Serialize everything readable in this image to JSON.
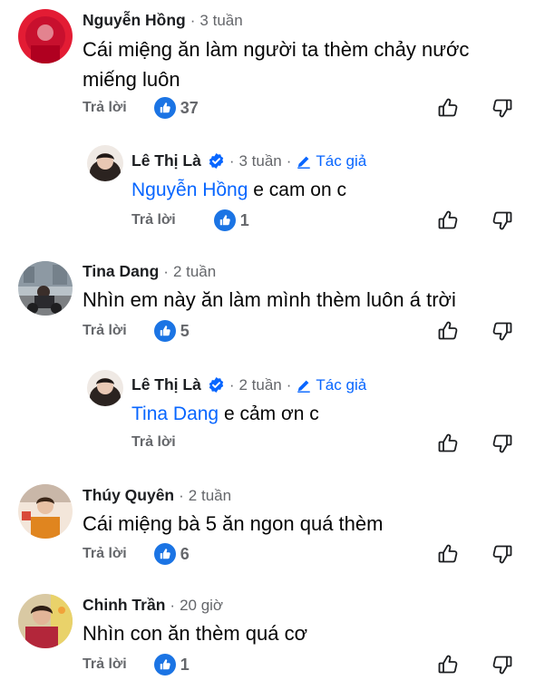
{
  "comments": [
    {
      "author": "Nguyễn Hồng",
      "time": "3 tuần",
      "text": "Cái miệng ăn làm người ta thèm chảy nước miếng luôn",
      "reply_label": "Trả lời",
      "likes": "37"
    },
    {
      "author": "Lê Thị Là",
      "time": "3 tuần",
      "author_badge": "Tác giả",
      "mention": "Nguyễn Hồng",
      "text": "e cam on c",
      "reply_label": "Trả lời",
      "likes": "1"
    },
    {
      "author": "Tina Dang",
      "time": "2 tuần",
      "text": "Nhìn em này ăn làm mình thèm luôn á trời",
      "reply_label": "Trả lời",
      "likes": "5"
    },
    {
      "author": "Lê Thị Là",
      "time": "2 tuần",
      "author_badge": "Tác giả",
      "mention": "Tina Dang",
      "text": "e cảm ơn c",
      "reply_label": "Trả lời"
    },
    {
      "author": "Thúy Quyên",
      "time": "2 tuần",
      "text": "Cái miệng bà 5 ăn ngon quá thèm",
      "reply_label": "Trả lời",
      "likes": "6"
    },
    {
      "author": "Chinh Trần",
      "time": "20 giờ",
      "text": "Nhìn con ăn thèm quá cơ",
      "reply_label": "Trả lời",
      "likes": "1"
    }
  ],
  "colors": {
    "accent": "#0866ff",
    "like_blue": "#1b74e4",
    "secondary_text": "#65676b"
  },
  "icons": {
    "like_badge": "thumbs-up-icon",
    "upvote": "thumbs-up-outline-icon",
    "downvote": "thumbs-down-outline-icon",
    "verified": "verified-badge-icon",
    "author": "pencil-icon"
  }
}
